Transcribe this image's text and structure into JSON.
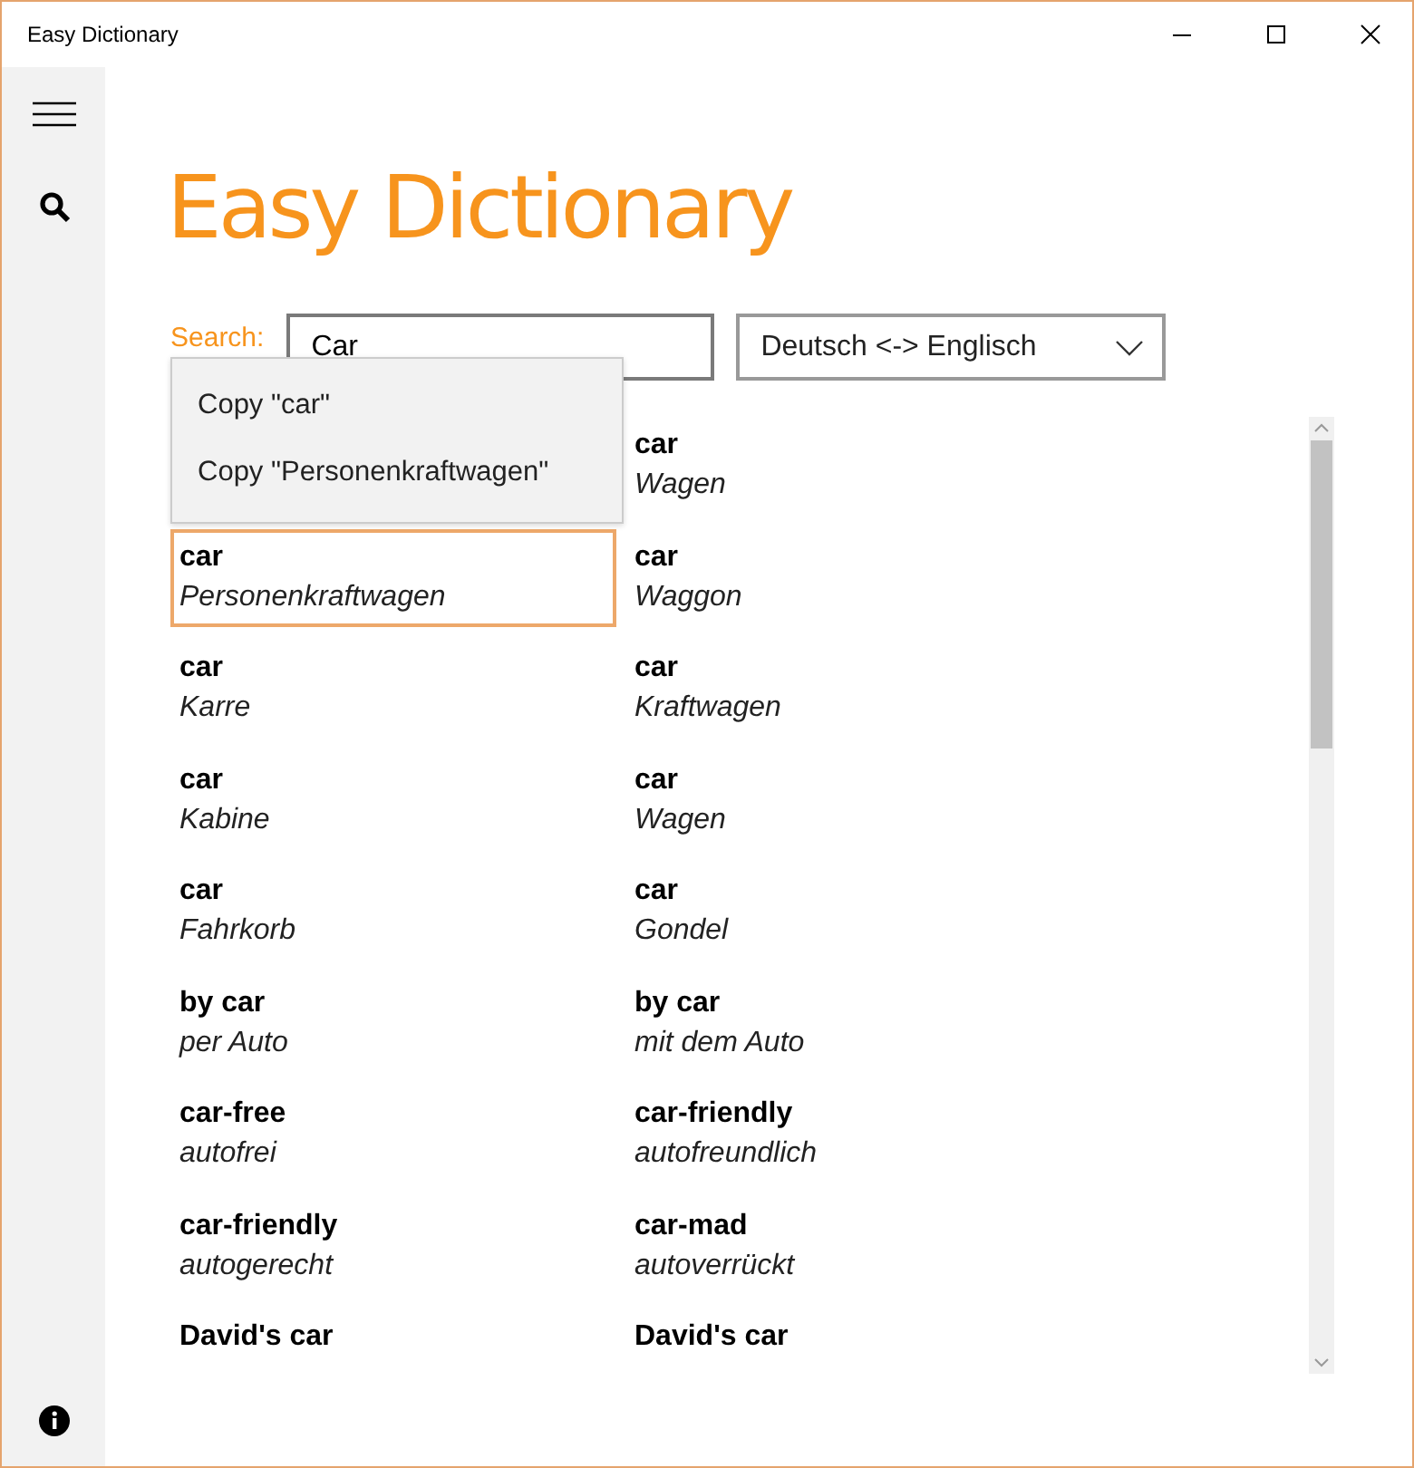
{
  "window": {
    "title": "Easy Dictionary"
  },
  "app_title": "Easy Dictionary",
  "search": {
    "label": "Search:",
    "value": "Car"
  },
  "language": {
    "value": "Deutsch <-> Englisch"
  },
  "context_menu": {
    "items": [
      "Copy \"car\"",
      "Copy \"Personenkraftwagen\""
    ]
  },
  "results": [
    {
      "right": {
        "term": "car",
        "translation": "Wagen",
        "selected": false
      }
    },
    {
      "left": {
        "term": "car",
        "translation": "Personenkraftwagen",
        "selected": true
      },
      "right": {
        "term": "car",
        "translation": "Waggon",
        "selected": false
      }
    },
    {
      "left": {
        "term": "car",
        "translation": "Karre",
        "selected": false
      },
      "right": {
        "term": "car",
        "translation": "Kraftwagen",
        "selected": false
      }
    },
    {
      "left": {
        "term": "car",
        "translation": "Kabine",
        "selected": false
      },
      "right": {
        "term": "car",
        "translation": "Wagen",
        "selected": false
      }
    },
    {
      "left": {
        "term": "car",
        "translation": "Fahrkorb",
        "selected": false
      },
      "right": {
        "term": "car",
        "translation": "Gondel",
        "selected": false
      }
    },
    {
      "left": {
        "term": "by car",
        "translation": "per Auto",
        "selected": false
      },
      "right": {
        "term": "by car",
        "translation": "mit dem Auto",
        "selected": false
      }
    },
    {
      "left": {
        "term": "car-free",
        "translation": "autofrei",
        "selected": false
      },
      "right": {
        "term": "car-friendly",
        "translation": "autofreundlich",
        "selected": false
      }
    },
    {
      "left": {
        "term": "car-friendly",
        "translation": "autogerecht",
        "selected": false
      },
      "right": {
        "term": "car-mad",
        "translation": "autoverrückt",
        "selected": false
      }
    },
    {
      "left": {
        "term": "David's car",
        "selected": false
      },
      "right": {
        "term": "David's car",
        "selected": false
      }
    }
  ]
}
